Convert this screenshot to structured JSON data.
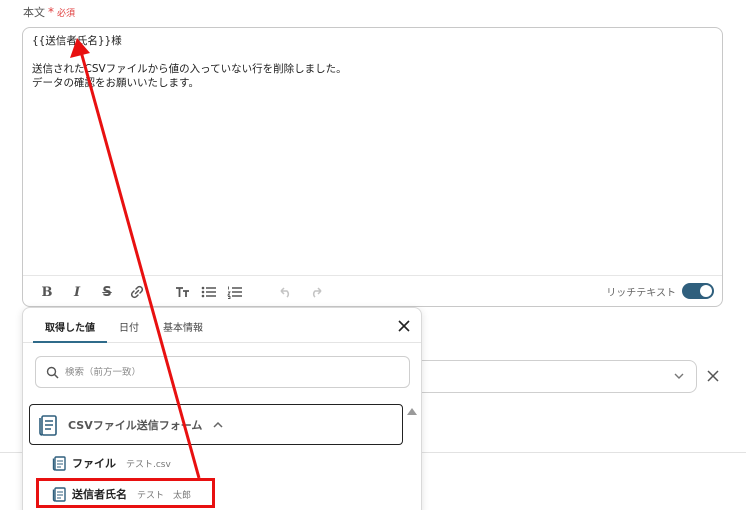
{
  "field": {
    "label": "本文",
    "required_mark": "*",
    "required_text": "必須"
  },
  "editor": {
    "text": "{{送信者氏名}}様\n\n送信されたCSVファイルから値の入っていない行を削除しました。\nデータの確認をお願いいたします。",
    "rich_text_label": "リッチテキスト",
    "rich_text_on": true,
    "toolbar_icons": [
      "bold-icon",
      "italic-icon",
      "strikethrough-icon",
      "link-icon",
      "text-size-icon",
      "bullet-list-icon",
      "numbered-list-icon",
      "undo-icon",
      "redo-icon"
    ]
  },
  "popover": {
    "tabs": [
      {
        "label": "取得した値",
        "active": true
      },
      {
        "label": "日付",
        "active": false
      },
      {
        "label": "基本情報",
        "active": false
      }
    ],
    "search_placeholder": "検索（前方一致）",
    "group": {
      "label": "CSVファイル送信フォーム",
      "expanded": true
    },
    "items": [
      {
        "label": "ファイル",
        "value": "テスト.csv"
      },
      {
        "label": "送信者氏名",
        "value": "テスト　太郎"
      }
    ]
  },
  "colors": {
    "accent": "#2f5f7d",
    "required": "#e03c3c",
    "annotation": "#e81010"
  }
}
